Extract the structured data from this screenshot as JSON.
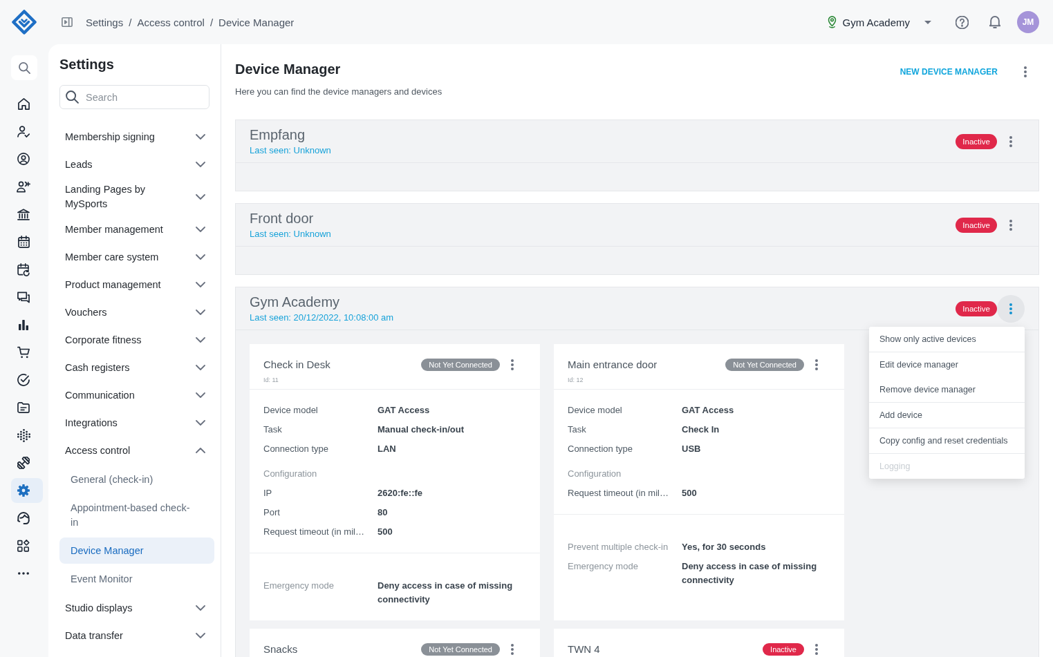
{
  "topbar": {
    "breadcrumb": [
      {
        "kind": "link",
        "text": "Settings"
      },
      {
        "kind": "separator",
        "text": "/"
      },
      {
        "kind": "link",
        "text": "Access control"
      },
      {
        "kind": "separator",
        "text": "/"
      },
      {
        "kind": "link",
        "text": "Device Manager"
      }
    ],
    "location": "Gym Academy",
    "avatar": "JM"
  },
  "rail": {
    "items": [
      {
        "selected": false
      },
      {
        "selected": false
      },
      {
        "selected": false
      },
      {
        "selected": false
      },
      {
        "selected": false
      },
      {
        "selected": false
      },
      {
        "selected": false
      },
      {
        "selected": false
      },
      {
        "selected": false
      },
      {
        "selected": false
      },
      {
        "selected": false
      },
      {
        "selected": false
      },
      {
        "selected": false
      },
      {
        "selected": false
      },
      {
        "selected": true
      },
      {
        "selected": false
      },
      {
        "selected": false
      },
      {
        "selected": false
      }
    ]
  },
  "sidebar": {
    "title": "Settings",
    "search": {
      "placeholder": "Search"
    },
    "items": [
      {
        "label": "Membership signing",
        "expanded": false
      },
      {
        "label": "Leads",
        "expanded": false
      },
      {
        "label": "Landing Pages by MySports",
        "expanded": false
      },
      {
        "label": "Member management",
        "expanded": false
      },
      {
        "label": "Member care system",
        "expanded": false
      },
      {
        "label": "Product management",
        "expanded": false
      },
      {
        "label": "Vouchers",
        "expanded": false
      },
      {
        "label": "Corporate fitness",
        "expanded": false
      },
      {
        "label": "Cash registers",
        "expanded": false
      },
      {
        "label": "Communication",
        "expanded": false
      },
      {
        "label": "Integrations",
        "expanded": false
      },
      {
        "label": "Access control",
        "expanded": true,
        "children": [
          {
            "label": "General (check-in)",
            "selected": false
          },
          {
            "label": "Appointment-based check-in",
            "selected": false
          },
          {
            "label": "Device Manager",
            "selected": true
          },
          {
            "label": "Event Monitor",
            "selected": false
          }
        ]
      },
      {
        "label": "Studio displays",
        "expanded": false
      },
      {
        "label": "Data transfer",
        "expanded": false
      }
    ]
  },
  "page": {
    "title": "Device Manager",
    "subtitle": "Here you can find the device managers and devices",
    "action": "NEW DEVICE MANAGER"
  },
  "managers": [
    {
      "name": "Empfang",
      "last_seen": "Last seen: Unknown",
      "status": {
        "label": "Inactive",
        "color": "#e0284a"
      },
      "menu_open": false
    },
    {
      "name": "Front door",
      "last_seen": "Last seen: Unknown",
      "status": {
        "label": "Inactive",
        "color": "#e0284a"
      },
      "menu_open": false
    },
    {
      "name": "Gym Academy",
      "last_seen": "Last seen: 20/12/2022, 10:08:00 am",
      "status": {
        "label": "Inactive",
        "color": "#e0284a"
      },
      "menu_open": true,
      "menu": [
        {
          "items": [
            {
              "label": "Show only active devices",
              "disabled": false
            }
          ]
        },
        {
          "items": [
            {
              "label": "Edit device manager",
              "disabled": false
            },
            {
              "label": "Remove device manager",
              "disabled": false
            }
          ]
        },
        {
          "items": [
            {
              "label": "Add device",
              "disabled": false
            }
          ]
        },
        {
          "items": [
            {
              "label": "Copy config and reset credentials",
              "disabled": false
            }
          ]
        },
        {
          "items": [
            {
              "label": "Logging",
              "disabled": true
            }
          ]
        }
      ],
      "devices": [
        {
          "name": "Check in Desk",
          "id": "Id: 11",
          "status": {
            "label": "Not Yet Connected",
            "color": "#8a9097"
          },
          "details": [
            {
              "label": "Device model",
              "value": "GAT Access"
            },
            {
              "label": "Task",
              "value": "Manual check-in/out"
            },
            {
              "label": "Connection type",
              "value": "LAN"
            }
          ],
          "configuration": {
            "title": "Configuration",
            "rows": [
              {
                "label": "IP",
                "value": "2620:fe::fe"
              },
              {
                "label": "Port",
                "value": "80"
              },
              {
                "label": "Request timeout (in mil…",
                "value": "500"
              }
            ]
          },
          "settings": [
            {
              "label": "Emergency mode",
              "value": "Deny access in case of missing connectivity"
            }
          ]
        },
        {
          "name": "Main entrance door",
          "id": "Id: 12",
          "status": {
            "label": "Not Yet Connected",
            "color": "#8a9097"
          },
          "details": [
            {
              "label": "Device model",
              "value": "GAT Access"
            },
            {
              "label": "Task",
              "value": "Check In"
            },
            {
              "label": "Connection type",
              "value": "USB"
            }
          ],
          "configuration": {
            "title": "Configuration",
            "rows": [
              {
                "label": "Request timeout (in mil…",
                "value": "500"
              }
            ]
          },
          "settings": [
            {
              "label": "Prevent multiple check-in",
              "value": "Yes, for 30 seconds"
            },
            {
              "label": "Emergency mode",
              "value": "Deny access in case of missing connectivity"
            }
          ]
        },
        {
          "name": "Snacks",
          "status": {
            "label": "Not Yet Connected",
            "color": "#8a9097"
          }
        },
        {
          "name": "TWN 4",
          "status": {
            "label": "Inactive",
            "color": "#e0284a"
          }
        }
      ]
    }
  ]
}
